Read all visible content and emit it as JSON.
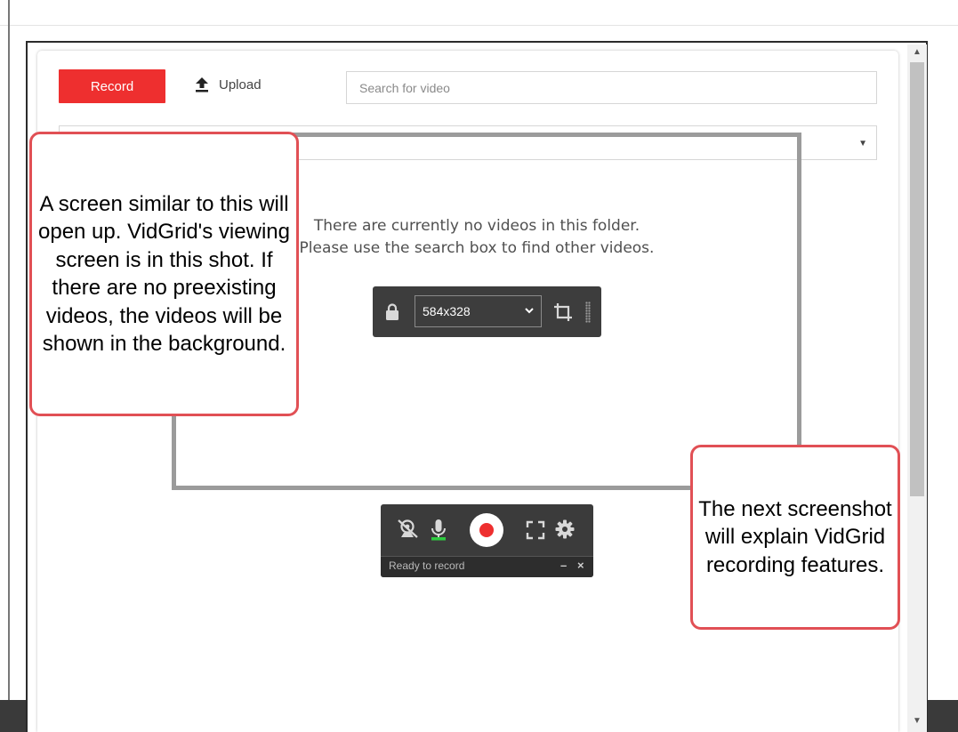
{
  "toolbar": {
    "record_label": "Record",
    "upload_label": "Upload",
    "search_placeholder": "Search for video"
  },
  "folder_select": {
    "selected": ""
  },
  "empty_state": {
    "line1": "There are currently no videos in this folder.",
    "line2": "Please use the search box to find other videos."
  },
  "capture_toolbar": {
    "size_value": "584x328",
    "icons": [
      "lock-icon",
      "chevron-down-icon",
      "crop-icon",
      "grip-icon"
    ]
  },
  "record_toolbar": {
    "status": "Ready to record",
    "minimize_label": "–",
    "close_label": "×",
    "icons": [
      "webcam-off-icon",
      "microphone-icon",
      "record-icon",
      "fullscreen-icon",
      "gear-icon"
    ]
  },
  "callouts": {
    "left": "A screen similar to this will open up. VidGrid's viewing screen is in this shot. If there are no preexisting videos, the videos will be shown in the background.",
    "right": "The next screenshot will explain VidGrid recording features."
  },
  "colors": {
    "record_red": "#ee2f2f",
    "callout_border": "#e15055",
    "toolbar_dark": "#3d3d3d",
    "mic_green": "#2ecc40"
  }
}
